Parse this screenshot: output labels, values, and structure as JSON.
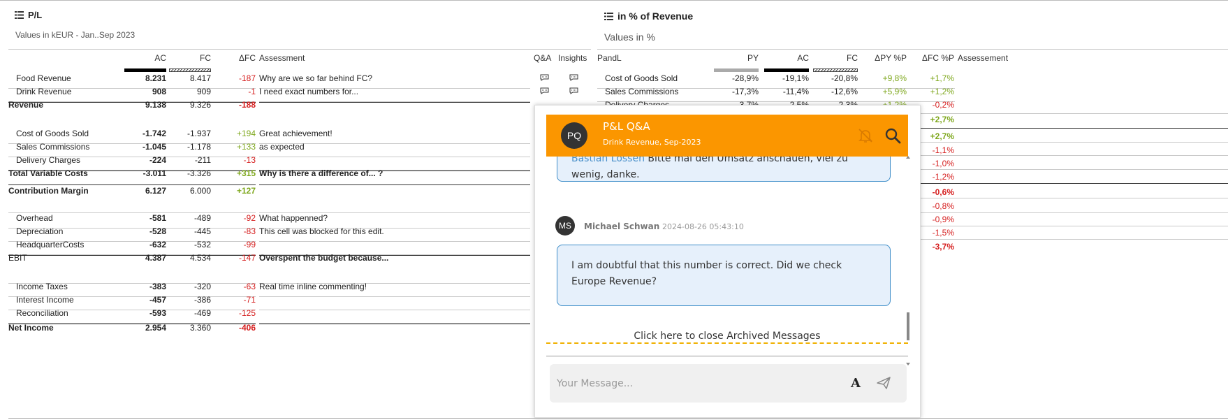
{
  "left_panel": {
    "title": "P/L",
    "subtitle": "Values in kEUR - Jan..Sep 2023",
    "headers": {
      "ac": "AC",
      "fc": "FC",
      "dfc": "ΔFC",
      "assessment": "Assessment",
      "qa": "Q&A",
      "insights": "Insights"
    },
    "rows": [
      {
        "label": "Food Revenue",
        "ac": "8.231",
        "fc": "8.417",
        "dfc": "-187",
        "dfc_color": "red",
        "note": "Why are we so far behind FC?",
        "bold": false,
        "indent": true
      },
      {
        "label": "Drink Revenue",
        "ac": "908",
        "fc": "909",
        "dfc": "-1",
        "dfc_color": "red",
        "note": "I need exact numbers for...",
        "bold": false,
        "indent": true
      },
      {
        "label": "Revenue",
        "ac": "9.138",
        "fc": "9.326",
        "dfc": "-188",
        "dfc_color": "red",
        "note": "",
        "bold": true,
        "indent": false
      },
      {
        "label": "Cost of Goods Sold",
        "ac": "-1.742",
        "fc": "-1.937",
        "dfc": "+194",
        "dfc_color": "green",
        "note": "Great achievement!",
        "bold": false,
        "indent": true
      },
      {
        "label": "Sales Commissions",
        "ac": "-1.045",
        "fc": "-1.178",
        "dfc": "+133",
        "dfc_color": "green",
        "note": "as expected",
        "bold": false,
        "indent": true
      },
      {
        "label": "Delivery Charges",
        "ac": "-224",
        "fc": "-211",
        "dfc": "-13",
        "dfc_color": "red",
        "note": "",
        "bold": false,
        "indent": true
      },
      {
        "label": "Total Variable Costs",
        "ac": "-3.011",
        "fc": "-3.326",
        "dfc": "+315",
        "dfc_color": "green",
        "note": "Why is there a difference of... ?",
        "bold": true,
        "indent": false
      },
      {
        "label": "Contribution Margin",
        "ac": "6.127",
        "fc": "6.000",
        "dfc": "+127",
        "dfc_color": "green",
        "note": "",
        "bold": true,
        "indent": false
      },
      {
        "label": "Overhead",
        "ac": "-581",
        "fc": "-489",
        "dfc": "-92",
        "dfc_color": "red",
        "note": "What happenned?",
        "bold": false,
        "indent": true
      },
      {
        "label": "Depreciation",
        "ac": "-528",
        "fc": "-445",
        "dfc": "-83",
        "dfc_color": "red",
        "note": "This cell was blocked for this edit.",
        "bold": false,
        "indent": true
      },
      {
        "label": "HeadquarterCosts",
        "ac": "-632",
        "fc": "-532",
        "dfc": "-99",
        "dfc_color": "red",
        "note": "",
        "bold": false,
        "indent": true
      },
      {
        "label": "EBIT",
        "ac": "4.387",
        "fc": "4.534",
        "dfc": "-147",
        "dfc_color": "red",
        "note": "Overspent the budget because...",
        "bold": false,
        "indent": false,
        "note_bold": true
      },
      {
        "label": "Income Taxes",
        "ac": "-383",
        "fc": "-320",
        "dfc": "-63",
        "dfc_color": "red",
        "note": "Real time inline commenting!",
        "bold": false,
        "indent": true
      },
      {
        "label": "Interest Income",
        "ac": "-457",
        "fc": "-386",
        "dfc": "-71",
        "dfc_color": "red",
        "note": "",
        "bold": false,
        "indent": true
      },
      {
        "label": "Reconciliation",
        "ac": "-593",
        "fc": "-469",
        "dfc": "-125",
        "dfc_color": "red",
        "note": "",
        "bold": false,
        "indent": true
      },
      {
        "label": "Net Income",
        "ac": "2.954",
        "fc": "3.360",
        "dfc": "-406",
        "dfc_color": "red",
        "note": "",
        "bold": true,
        "indent": false
      }
    ]
  },
  "right_panel": {
    "title": "in % of Revenue",
    "subtitle": "Values in %",
    "headers": {
      "pandl": "PandL",
      "py": "PY",
      "ac": "AC",
      "fc": "FC",
      "dpy": "ΔPY %P",
      "dfc": "ΔFC %P",
      "assessment": "Assessement"
    },
    "rows": [
      {
        "label": "Cost of Goods Sold",
        "py": "-28,9%",
        "ac": "-19,1%",
        "fc": "-20,8%",
        "dpy": "+9,8%",
        "dfc": "+1,7%",
        "dfc_color": "green"
      },
      {
        "label": "Sales Commissions",
        "py": "-17,3%",
        "ac": "-11,4%",
        "fc": "-12,6%",
        "dpy": "+5,9%",
        "dfc": "+1,2%",
        "dfc_color": "green"
      },
      {
        "label": "Delivery Charges",
        "py": "-3,7%",
        "ac": "-2,5%",
        "fc": "-2,3%",
        "dpy": "+1,2%",
        "dfc": "-0,2%",
        "dfc_color": "red"
      }
    ],
    "dfc_visible": [
      {
        "v": "+2,7%",
        "color": "green",
        "bold": true
      },
      {
        "v": "+2,7%",
        "color": "green",
        "bold": true
      },
      {
        "v": "-1,1%",
        "color": "red",
        "bold": false
      },
      {
        "v": "-1,0%",
        "color": "red",
        "bold": false
      },
      {
        "v": "-1,2%",
        "color": "red",
        "bold": false
      },
      {
        "v": "-0,6%",
        "color": "red",
        "bold": true
      },
      {
        "v": "-0,8%",
        "color": "red",
        "bold": false
      },
      {
        "v": "-0,9%",
        "color": "red",
        "bold": false
      },
      {
        "v": "-1,5%",
        "color": "red",
        "bold": false
      },
      {
        "v": "-3,7%",
        "color": "red",
        "bold": true
      }
    ]
  },
  "chat": {
    "avatar_initials": "PQ",
    "title": "P&L Q&A",
    "subtitle": "Drink Revenue, Sep-2023",
    "partial_message_author": "Bastian Lossen",
    "partial_message_text_line1": " Bitte mal den Umsatz anschauen, viel zu",
    "partial_message_text_line2": "wenig, danke.",
    "message": {
      "initials": "MS",
      "author": "Michael Schwan",
      "time": "2024-08-26 05:43:10",
      "text_line1": "I am doubtful that this number is correct. Did we check",
      "text_line2": "Europe Revenue?"
    },
    "archived_link": "Click here to close Archived Messages",
    "composer_placeholder": "Your Message..."
  },
  "colors": {
    "accent": "#fb9600",
    "red": "#d62020",
    "green": "#7fa81e",
    "bubble_border": "#3f8ec9",
    "bubble_bg": "#e6f0fb"
  }
}
